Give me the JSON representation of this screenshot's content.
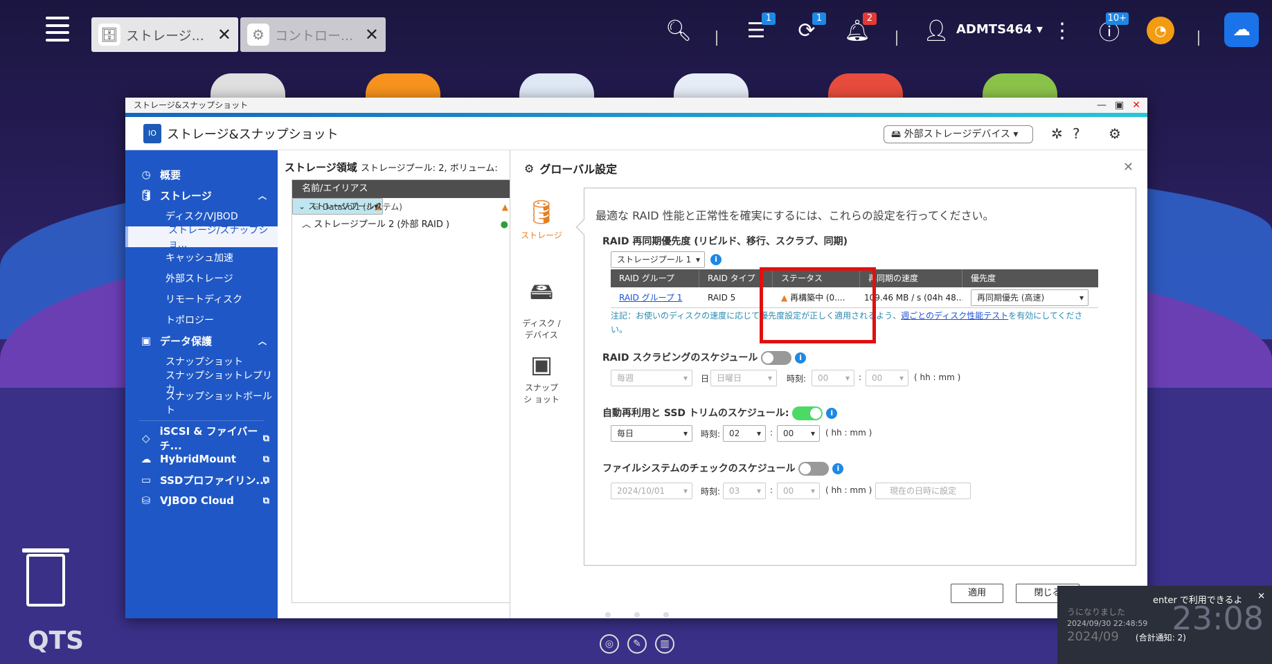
{
  "desktop": {
    "tabs": [
      {
        "label": "ストレージ...",
        "icon": "storage-icon"
      },
      {
        "label": "コントロー...",
        "icon": "gear-icon"
      }
    ],
    "badges": {
      "tasks": "1",
      "backup": "1",
      "notifications": "2",
      "updates": "10+"
    },
    "user": "ADMTS464",
    "brand": "QTS",
    "notification": {
      "line1": "enter で利用できるよ",
      "line2": "うになりました",
      "time1": "2024/09/30 22:48:59",
      "date2": "2024/09",
      "total": "(合計通知: 2)",
      "clock": "23:08"
    }
  },
  "window": {
    "title": "ストレージ&スナップショット",
    "app_title": "ストレージ&スナップショット",
    "external_device": "外部ストレージデバイス"
  },
  "sidebar": {
    "items": [
      {
        "label": "概要",
        "type": "main"
      },
      {
        "label": "ストレージ",
        "type": "main"
      },
      {
        "label": "ディスク/VJBOD",
        "type": "sub"
      },
      {
        "label": "ストレージ/スナップショ...",
        "type": "sub"
      },
      {
        "label": "キャッシュ加速",
        "type": "sub"
      },
      {
        "label": "外部ストレージ",
        "type": "sub"
      },
      {
        "label": "リモートディスク",
        "type": "sub"
      },
      {
        "label": "トポロジー",
        "type": "sub"
      },
      {
        "label": "データ保護",
        "type": "main"
      },
      {
        "label": "スナップショット",
        "type": "sub"
      },
      {
        "label": "スナップショットレプリカ",
        "type": "sub"
      },
      {
        "label": "スナップショットボールト",
        "type": "sub"
      },
      {
        "label": "iSCSI & ファイバーチ...",
        "type": "main"
      },
      {
        "label": "HybridMount",
        "type": "main"
      },
      {
        "label": "SSDプロファイリン...",
        "type": "main"
      },
      {
        "label": "VJBOD Cloud",
        "type": "main"
      }
    ]
  },
  "middle": {
    "title": "ストレージ領域",
    "summary": "ストレージプール: 2, ボリューム:",
    "column": "名前/エイリアス",
    "rows": [
      {
        "label": "ストレージプール 1"
      },
      {
        "label": "DataVol1 (システム)"
      },
      {
        "label": "ストレージプール 2 (外部 RAID )"
      }
    ]
  },
  "dialog": {
    "title": "グローバル設定",
    "nav": [
      {
        "label": "ストレージ"
      },
      {
        "label": "ディスク / デバイス"
      },
      {
        "label": "スナップシ ョット"
      }
    ],
    "intro": "最適な RAID 性能と正常性を確実にするには、これらの設定を行ってください。",
    "resync": {
      "heading": "RAID 再同期優先度 (リビルド、移行、スクラブ、同期)",
      "pool_select": "ストレージプール 1",
      "headers": [
        "RAID グループ",
        "RAID タイプ",
        "ステータス",
        "再同期の速度",
        "優先度"
      ],
      "row": {
        "group": "RAID グループ 1",
        "type": "RAID 5",
        "status": "再構築中 (0....",
        "speed": "109.46 MB / s (04h 48...",
        "priority": "再同期優先 (高速)"
      },
      "note_pre": "注記：お使いのディスクの速度に応じて優先度設定が正しく適用されるよう、",
      "note_link": "週ごとのディスク性能テスト",
      "note_post": "を有効にしてくださ い。"
    },
    "scrub": {
      "heading": "RAID スクラビングのスケジュール",
      "freq": "毎週",
      "day_label": "日",
      "day": "日曜日",
      "time_label": "時刻:",
      "hour": "00",
      "min": "00",
      "unit": "( hh : mm )"
    },
    "trim": {
      "heading": "自動再利用と SSD トリムのスケジュール:",
      "freq": "毎日",
      "time_label": "時刻:",
      "hour": "02",
      "min": "00",
      "unit": "( hh : mm )"
    },
    "fscheck": {
      "heading": "ファイルシステムのチェックのスケジュール",
      "date": "2024/10/01",
      "time_label": "時刻:",
      "hour": "03",
      "min": "00",
      "unit": "( hh : mm )",
      "now_btn": "現在の日時に設定"
    },
    "apply": "適用",
    "close": "閉じる"
  }
}
